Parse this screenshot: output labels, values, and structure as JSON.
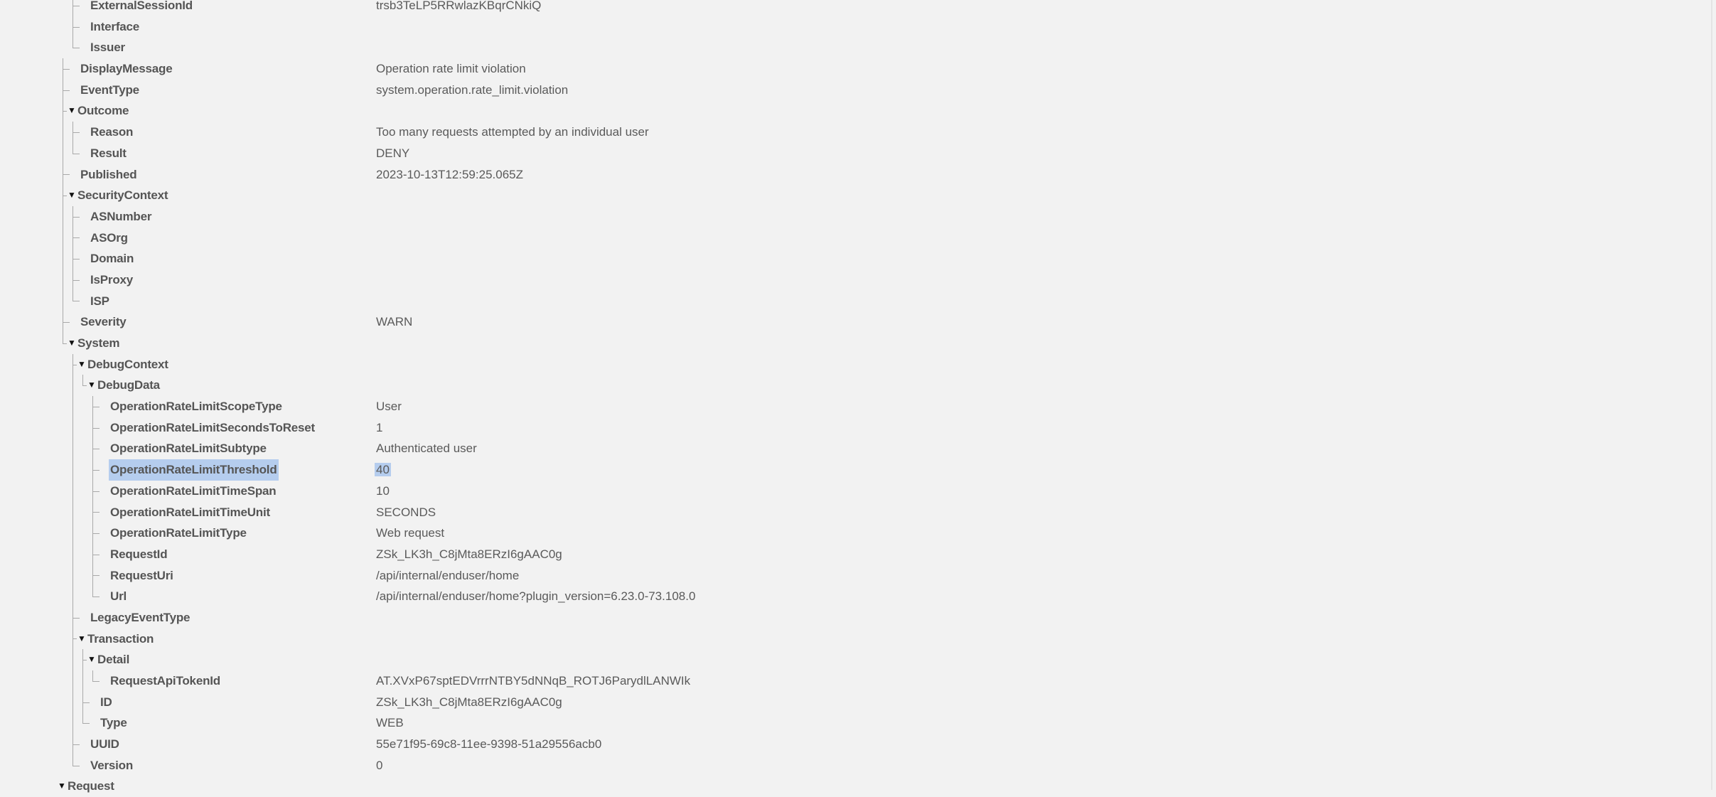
{
  "highlight_color": "#b5cdee",
  "rows": [
    {
      "depth": 2,
      "key": "ExternalSessionId",
      "value": "trsb3TeLP5RRwlazKBqrCNkiQ",
      "last": false
    },
    {
      "depth": 2,
      "key": "Interface",
      "value": "",
      "last": false
    },
    {
      "depth": 2,
      "key": "Issuer",
      "value": "",
      "last": true
    },
    {
      "depth": 1,
      "key": "DisplayMessage",
      "value": "Operation rate limit violation",
      "last": false
    },
    {
      "depth": 1,
      "key": "EventType",
      "value": "system.operation.rate_limit.violation",
      "last": false
    },
    {
      "depth": 1,
      "key": "Outcome",
      "value": "",
      "expanded": true,
      "last": false
    },
    {
      "depth": 2,
      "key": "Reason",
      "value": "Too many requests attempted by an individual user",
      "last": false
    },
    {
      "depth": 2,
      "key": "Result",
      "value": "DENY",
      "last": true
    },
    {
      "depth": 1,
      "key": "Published",
      "value": "2023-10-13T12:59:25.065Z",
      "last": false
    },
    {
      "depth": 1,
      "key": "SecurityContext",
      "value": "",
      "expanded": true,
      "last": false
    },
    {
      "depth": 2,
      "key": "ASNumber",
      "value": "",
      "last": false
    },
    {
      "depth": 2,
      "key": "ASOrg",
      "value": "",
      "last": false
    },
    {
      "depth": 2,
      "key": "Domain",
      "value": "",
      "last": false
    },
    {
      "depth": 2,
      "key": "IsProxy",
      "value": "",
      "last": false
    },
    {
      "depth": 2,
      "key": "ISP",
      "value": "",
      "last": true
    },
    {
      "depth": 1,
      "key": "Severity",
      "value": "WARN",
      "last": false
    },
    {
      "depth": 1,
      "key": "System",
      "value": "",
      "expanded": true,
      "last": true
    },
    {
      "depth": 2,
      "key": "DebugContext",
      "value": "",
      "expanded": true,
      "last": false
    },
    {
      "depth": 3,
      "key": "DebugData",
      "value": "",
      "expanded": true,
      "last": true
    },
    {
      "depth": 4,
      "key": "OperationRateLimitScopeType",
      "value": "User",
      "last": false
    },
    {
      "depth": 4,
      "key": "OperationRateLimitSecondsToReset",
      "value": "1",
      "last": false
    },
    {
      "depth": 4,
      "key": "OperationRateLimitSubtype",
      "value": "Authenticated user",
      "last": false
    },
    {
      "depth": 4,
      "key": "OperationRateLimitThreshold",
      "value": "40",
      "selected": true,
      "last": false
    },
    {
      "depth": 4,
      "key": "OperationRateLimitTimeSpan",
      "value": "10",
      "last": false
    },
    {
      "depth": 4,
      "key": "OperationRateLimitTimeUnit",
      "value": "SECONDS",
      "last": false
    },
    {
      "depth": 4,
      "key": "OperationRateLimitType",
      "value": "Web request",
      "last": false
    },
    {
      "depth": 4,
      "key": "RequestId",
      "value": "ZSk_LK3h_C8jMta8ERzI6gAAC0g",
      "last": false
    },
    {
      "depth": 4,
      "key": "RequestUri",
      "value": "/api/internal/enduser/home",
      "last": false
    },
    {
      "depth": 4,
      "key": "Url",
      "value": "/api/internal/enduser/home?plugin_version=6.23.0-73.108.0",
      "last": true
    },
    {
      "depth": 2,
      "key": "LegacyEventType",
      "value": "",
      "last": false
    },
    {
      "depth": 2,
      "key": "Transaction",
      "value": "",
      "expanded": true,
      "last": false
    },
    {
      "depth": 3,
      "key": "Detail",
      "value": "",
      "expanded": true,
      "last": false
    },
    {
      "depth": 4,
      "key": "RequestApiTokenId",
      "value": "AT.XVxP67sptEDVrrrNTBY5dNNqB_ROTJ6ParydlLANWIk",
      "last": true
    },
    {
      "depth": 3,
      "key": "ID",
      "value": "ZSk_LK3h_C8jMta8ERzI6gAAC0g",
      "last": false
    },
    {
      "depth": 3,
      "key": "Type",
      "value": "WEB",
      "last": true
    },
    {
      "depth": 2,
      "key": "UUID",
      "value": "55e71f95-69c8-11ee-9398-51a29556acb0",
      "last": false
    },
    {
      "depth": 2,
      "key": "Version",
      "value": "0",
      "last": true
    },
    {
      "depth": 0,
      "key": "Request",
      "value": "",
      "expanded": true,
      "last": false
    }
  ],
  "icons": {
    "expanded": "caret-down-icon"
  }
}
